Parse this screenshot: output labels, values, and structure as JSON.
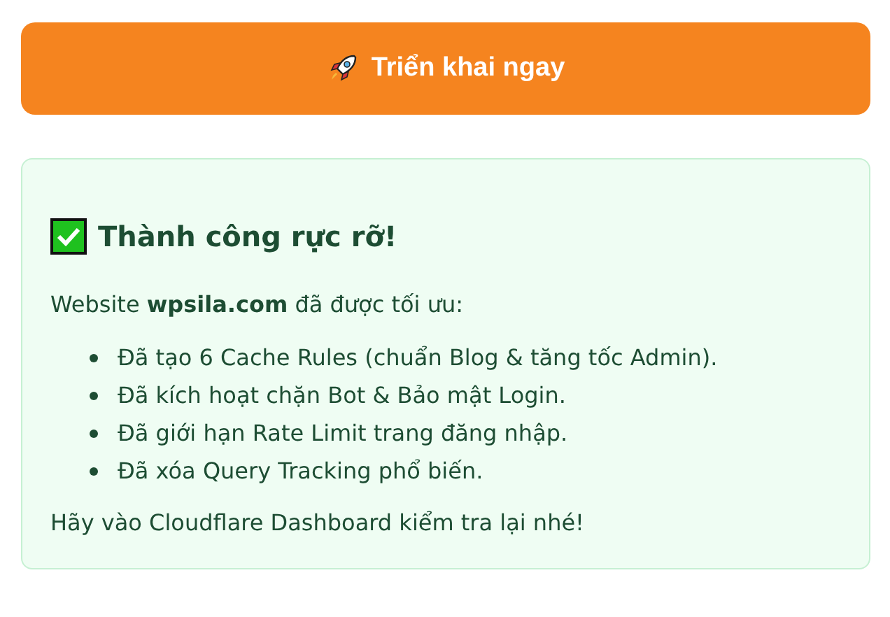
{
  "deploy_button": {
    "label": "Triển khai ngay"
  },
  "result": {
    "title": "Thành công rực rỡ!",
    "intro": "Website **wpsila.com** đã được tối ưu:",
    "items": [
      "Đã tạo 6 Cache Rules (chuẩn Blog & tăng tốc Admin).",
      "Đã kích hoạt chặn Bot & Bảo mật Login.",
      "Đã giới hạn Rate Limit trang đăng nhập.",
      "Đã xóa Query Tracking phổ biến."
    ],
    "footer": "Hãy vào Cloudflare Dashboard kiểm tra lại nhé!"
  }
}
